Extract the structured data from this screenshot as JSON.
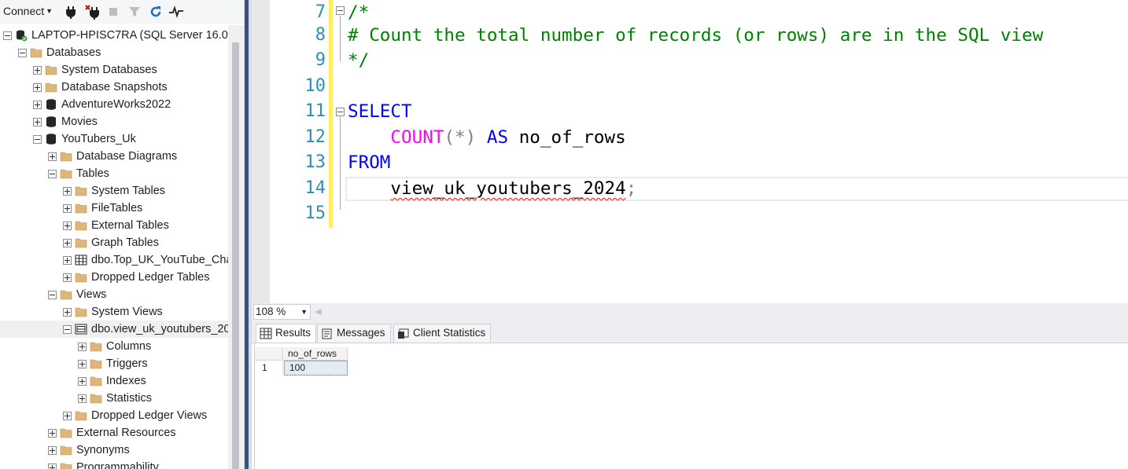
{
  "explorer": {
    "connect_label": "Connect",
    "tree": [
      {
        "label": "LAPTOP-HPISC7RA (SQL Server 16.0.1",
        "level": 0,
        "expander": "minus",
        "icon": "server-icon"
      },
      {
        "label": "Databases",
        "level": 1,
        "expander": "minus",
        "icon": "folder-icon"
      },
      {
        "label": "System Databases",
        "level": 2,
        "expander": "plus",
        "icon": "folder-icon"
      },
      {
        "label": "Database Snapshots",
        "level": 2,
        "expander": "plus",
        "icon": "folder-icon"
      },
      {
        "label": "AdventureWorks2022",
        "level": 2,
        "expander": "plus",
        "icon": "database-icon"
      },
      {
        "label": "Movies",
        "level": 2,
        "expander": "plus",
        "icon": "database-icon"
      },
      {
        "label": "YouTubers_Uk",
        "level": 2,
        "expander": "minus",
        "icon": "database-icon"
      },
      {
        "label": "Database Diagrams",
        "level": 3,
        "expander": "plus",
        "icon": "folder-icon"
      },
      {
        "label": "Tables",
        "level": 3,
        "expander": "minus",
        "icon": "folder-icon"
      },
      {
        "label": "System Tables",
        "level": 4,
        "expander": "plus",
        "icon": "folder-icon"
      },
      {
        "label": "FileTables",
        "level": 4,
        "expander": "plus",
        "icon": "folder-icon"
      },
      {
        "label": "External Tables",
        "level": 4,
        "expander": "plus",
        "icon": "folder-icon"
      },
      {
        "label": "Graph Tables",
        "level": 4,
        "expander": "plus",
        "icon": "folder-icon"
      },
      {
        "label": "dbo.Top_UK_YouTube_Cha",
        "level": 4,
        "expander": "plus",
        "icon": "table-icon"
      },
      {
        "label": "Dropped Ledger Tables",
        "level": 4,
        "expander": "plus",
        "icon": "folder-icon"
      },
      {
        "label": "Views",
        "level": 3,
        "expander": "minus",
        "icon": "folder-icon"
      },
      {
        "label": "System Views",
        "level": 4,
        "expander": "plus",
        "icon": "folder-icon"
      },
      {
        "label": "dbo.view_uk_youtubers_20",
        "level": 4,
        "expander": "minus",
        "icon": "view-icon",
        "selected": true
      },
      {
        "label": "Columns",
        "level": 5,
        "expander": "plus",
        "icon": "folder-icon"
      },
      {
        "label": "Triggers",
        "level": 5,
        "expander": "plus",
        "icon": "folder-icon"
      },
      {
        "label": "Indexes",
        "level": 5,
        "expander": "plus",
        "icon": "folder-icon"
      },
      {
        "label": "Statistics",
        "level": 5,
        "expander": "plus",
        "icon": "folder-icon"
      },
      {
        "label": "Dropped Ledger Views",
        "level": 4,
        "expander": "plus",
        "icon": "folder-icon"
      },
      {
        "label": "External Resources",
        "level": 3,
        "expander": "plus",
        "icon": "folder-icon"
      },
      {
        "label": "Synonyms",
        "level": 3,
        "expander": "plus",
        "icon": "folder-icon"
      },
      {
        "label": "Programmability",
        "level": 3,
        "expander": "plus",
        "icon": "folder-icon"
      }
    ]
  },
  "editor": {
    "line_numbers": [
      "7",
      "8",
      "9",
      "10",
      "11",
      "12",
      "13",
      "14",
      "15"
    ],
    "code": {
      "l7": "/*",
      "l8": "# Count the total number of records (or rows) are in the SQL view",
      "l9": "*/",
      "l11_kw": "SELECT",
      "l12_fn": "COUNT",
      "l12_args": "(*)",
      "l12_as": "AS",
      "l12_alias": "no_of_rows",
      "l13_kw": "FROM",
      "l14_view": "view_uk_youtubers_2024",
      "l14_semi": ";"
    }
  },
  "zoom": {
    "value": "108 %"
  },
  "results": {
    "tabs": [
      {
        "label": "Results",
        "icon": "grid-icon"
      },
      {
        "label": "Messages",
        "icon": "messages-icon"
      },
      {
        "label": "Client Statistics",
        "icon": "statistics-icon"
      }
    ],
    "columns": [
      "no_of_rows"
    ],
    "rows": [
      {
        "row_no": "1",
        "values": [
          "100"
        ]
      }
    ]
  },
  "colors": {
    "comment": "#008000",
    "keyword": "#0000ff",
    "function": "#ff00ff",
    "line_number": "#2b91af",
    "change_bar": "#ffee62",
    "splitter": "#3b4f81"
  }
}
